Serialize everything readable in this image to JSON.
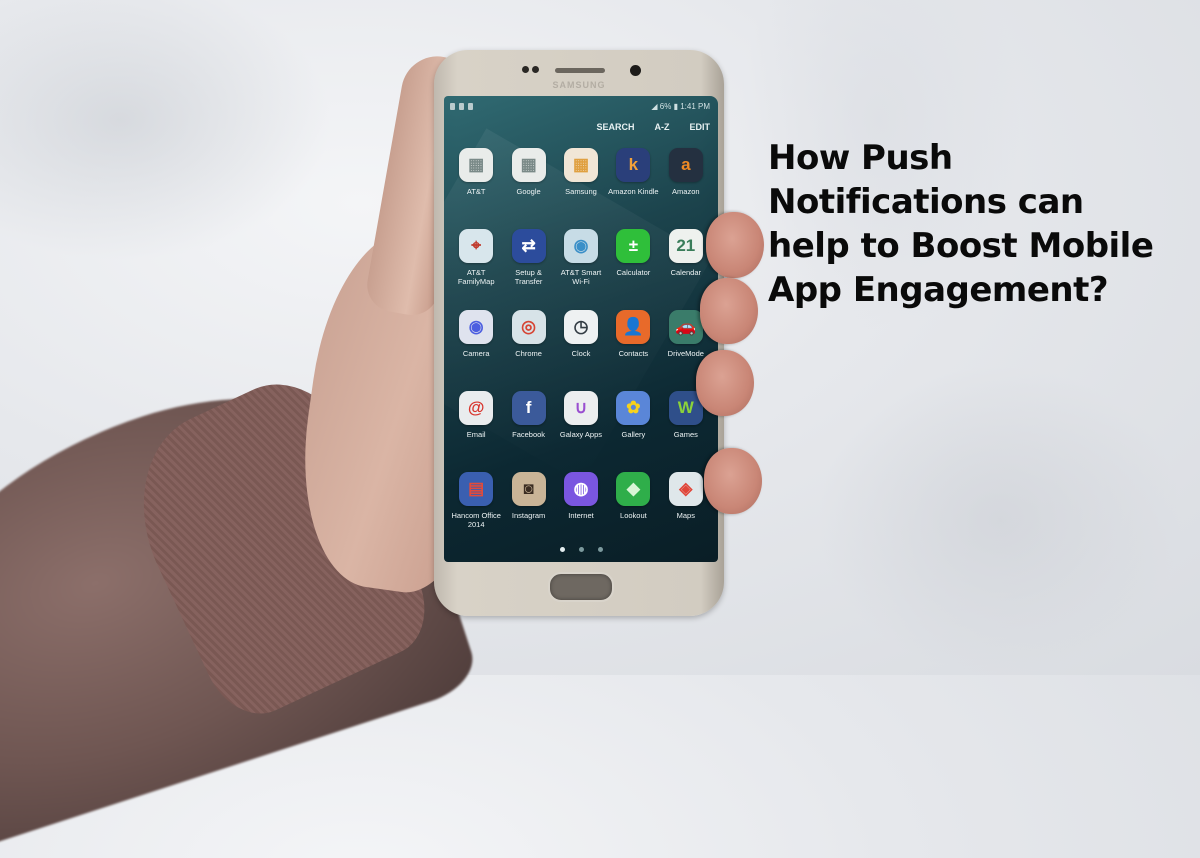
{
  "headline": {
    "lines": [
      "How Push",
      "Notifications can",
      "help to Boost Mobile",
      "App Engagement?"
    ]
  },
  "phone": {
    "brand": "SAMSUNG",
    "status_bar": {
      "battery": "6%",
      "time": "1:41 PM"
    },
    "action_bar": {
      "search": "SEARCH",
      "az": "A-Z",
      "edit": "EDIT"
    },
    "apps": [
      {
        "label": "AT&T",
        "icon": "folder-icon",
        "glyph": "▦",
        "color": "#e9ecea",
        "fg": "#7a8a88"
      },
      {
        "label": "Google",
        "icon": "folder-icon",
        "glyph": "▦",
        "color": "#e9ecea",
        "fg": "#7a8a88"
      },
      {
        "label": "Samsung",
        "icon": "folder-icon",
        "glyph": "▦",
        "color": "#f1e6d6",
        "fg": "#e0a040"
      },
      {
        "label": "Amazon Kindle",
        "icon": "kindle-icon",
        "glyph": "k",
        "color": "#2a3f7a",
        "fg": "#f2a23a"
      },
      {
        "label": "Amazon",
        "icon": "amazon-icon",
        "glyph": "a",
        "color": "#243040",
        "fg": "#f08a24"
      },
      {
        "label": "AT&T FamilyMap",
        "icon": "map-pin-icon",
        "glyph": "⌖",
        "color": "#d8e6ec",
        "fg": "#c0392b"
      },
      {
        "label": "Setup & Transfer",
        "icon": "transfer-icon",
        "glyph": "⇄",
        "color": "#2c4c9c",
        "fg": "#ffffff"
      },
      {
        "label": "AT&T Smart Wi-Fi",
        "icon": "wifi-globe-icon",
        "glyph": "◉",
        "color": "#c7dce6",
        "fg": "#3a8fc8"
      },
      {
        "label": "Calculator",
        "icon": "calculator-icon",
        "glyph": "±",
        "color": "#2fbf3a",
        "fg": "#ffffff"
      },
      {
        "label": "Calendar",
        "icon": "calendar-icon",
        "glyph": "21",
        "color": "#eef1ee",
        "fg": "#3a7d5a"
      },
      {
        "label": "Camera",
        "icon": "camera-icon",
        "glyph": "◉",
        "color": "#dfe3ee",
        "fg": "#4c5ee0"
      },
      {
        "label": "Chrome",
        "icon": "chrome-icon",
        "glyph": "◎",
        "color": "#d7e3e8",
        "fg": "#d64534"
      },
      {
        "label": "Clock",
        "icon": "clock-icon",
        "glyph": "◷",
        "color": "#eef1f2",
        "fg": "#333c44"
      },
      {
        "label": "Contacts",
        "icon": "contacts-icon",
        "glyph": "👤",
        "color": "#e86a2a",
        "fg": "#ffffff"
      },
      {
        "label": "DriveMode",
        "icon": "car-icon",
        "glyph": "🚗",
        "color": "#3a7c6a",
        "fg": "#ffffff"
      },
      {
        "label": "Email",
        "icon": "email-icon",
        "glyph": "@",
        "color": "#e9ecee",
        "fg": "#d8352e"
      },
      {
        "label": "Facebook",
        "icon": "facebook-icon",
        "glyph": "f",
        "color": "#3b5a9a",
        "fg": "#ffffff"
      },
      {
        "label": "Galaxy Apps",
        "icon": "galaxy-apps-icon",
        "glyph": "∪",
        "color": "#eceeef",
        "fg": "#9a4fd0"
      },
      {
        "label": "Gallery",
        "icon": "gallery-icon",
        "glyph": "✿",
        "color": "#5a86d8",
        "fg": "#f6d21c"
      },
      {
        "label": "Games",
        "icon": "games-icon",
        "glyph": "W",
        "color": "#2f4f8a",
        "fg": "#8bd23a"
      },
      {
        "label": "Hancom Office 2014",
        "icon": "office-icon",
        "glyph": "▤",
        "color": "#3a5fb0",
        "fg": "#e24b3b"
      },
      {
        "label": "Instagram",
        "icon": "instagram-icon",
        "glyph": "◙",
        "color": "#c9b497",
        "fg": "#3a2c22"
      },
      {
        "label": "Internet",
        "icon": "globe-icon",
        "glyph": "◍",
        "color": "#7a56e0",
        "fg": "#ffffff"
      },
      {
        "label": "Lookout",
        "icon": "shield-icon",
        "glyph": "◆",
        "color": "#2fae4a",
        "fg": "#d8f5d6"
      },
      {
        "label": "Maps",
        "icon": "maps-icon",
        "glyph": "◈",
        "color": "#dfe7ea",
        "fg": "#e04538"
      }
    ],
    "page_indicator": {
      "pages": 3,
      "active": 1
    }
  }
}
